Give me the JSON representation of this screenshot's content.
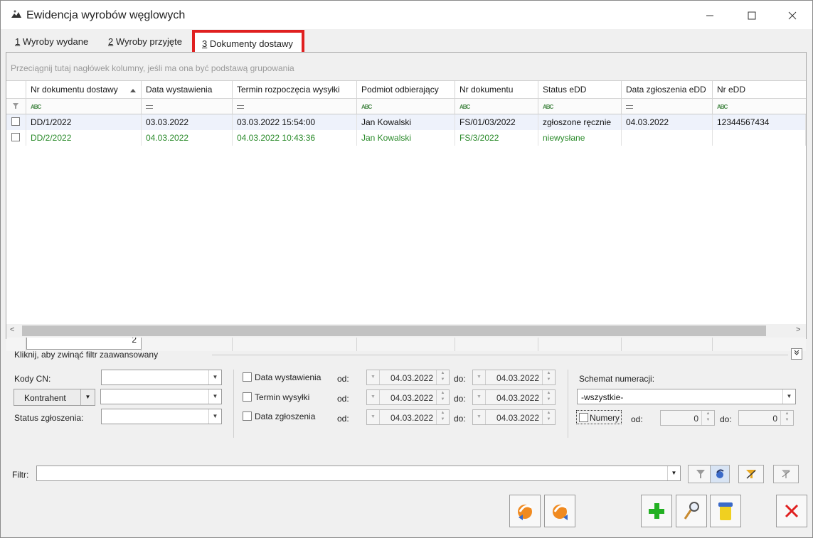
{
  "window": {
    "title": "Ewidencja wyrobów węglowych"
  },
  "tabs": [
    {
      "key": "1",
      "label": " Wyroby wydane"
    },
    {
      "key": "2",
      "label": " Wyroby przyjęte"
    },
    {
      "key": "3",
      "label": " Dokumenty dostawy"
    }
  ],
  "group_hint": "Przeciągnij tutaj nagłówek kolumny, jeśli ma ona być podstawą grupowania",
  "columns": [
    "Nr dokumentu dostawy",
    "Data wystawienia",
    "Termin rozpoczęcia wysyłki",
    "Podmiot odbierający",
    "Nr dokumentu",
    "Status eDD",
    "Data zgłoszenia eDD",
    "Nr eDD"
  ],
  "rows": [
    {
      "nr_dd": "DD/1/2022",
      "data": "03.03.2022",
      "termin": "03.03.2022 15:54:00",
      "podmiot": "Jan Kowalski",
      "nr_dok": "FS/01/03/2022",
      "status": "zgłoszone ręcznie",
      "data_zgl": "04.03.2022",
      "nr_edd": "12344567434"
    },
    {
      "nr_dd": "DD/2/2022",
      "data": "04.03.2022",
      "termin": "04.03.2022 10:43:36",
      "podmiot": "Jan Kowalski",
      "nr_dok": "FS/3/2022",
      "status": "niewysłane",
      "data_zgl": "",
      "nr_edd": ""
    }
  ],
  "footer_count": "2",
  "filter": {
    "title": "Kliknij, aby zwinąć filtr zaawansowany",
    "kody_cn_label": "Kody CN:",
    "kontrahent_label": "Kontrahent",
    "status_label": "Status zgłoszenia:",
    "data_wyst_label": "Data wystawienia",
    "termin_label": "Termin wysyłki",
    "data_zgl_label": "Data zgłoszenia",
    "od": "od:",
    "do": "do:",
    "date_value": "04.03.2022",
    "schemat_label": "Schemat numeracji:",
    "schemat_value": "-wszystkie-",
    "numery_label": "Numery",
    "numer_from": "0",
    "numer_to": "0",
    "filtr_label": "Filtr:"
  },
  "colors": {
    "highlight_border": "#e02020",
    "green_text": "#2a8a2a",
    "selected_row": "#eef2fb"
  },
  "icons": [
    "app-icon",
    "filter-icon",
    "filter-clear-icon",
    "eco-export-icon",
    "eco-import-icon",
    "add-icon",
    "edit-icon",
    "delete-icon",
    "close-icon"
  ]
}
